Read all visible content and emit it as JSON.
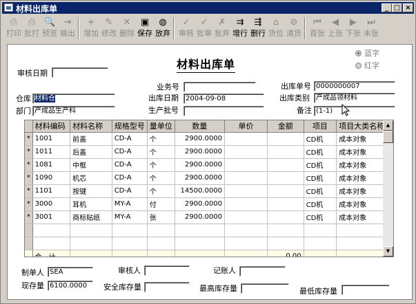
{
  "window": {
    "title": "材料出库单",
    "controls": [
      "_",
      "□",
      "×"
    ]
  },
  "toolbar": [
    {
      "label": "打印",
      "icon": "print-icon",
      "glyph": "⎙",
      "enabled": false
    },
    {
      "label": "批打",
      "icon": "batch-print-icon",
      "glyph": "⎙",
      "enabled": false
    },
    {
      "label": "预览",
      "icon": "preview-icon",
      "glyph": "🔍",
      "enabled": false
    },
    {
      "label": "输出",
      "icon": "export-icon",
      "glyph": "⇥",
      "enabled": false
    },
    {
      "label": "增加",
      "icon": "add-icon",
      "glyph": "+",
      "enabled": false
    },
    {
      "label": "修改",
      "icon": "edit-icon",
      "glyph": "✎",
      "enabled": false
    },
    {
      "label": "删除",
      "icon": "delete-icon",
      "glyph": "✕",
      "enabled": false
    },
    {
      "label": "保存",
      "icon": "save-icon",
      "glyph": "▣",
      "enabled": true
    },
    {
      "label": "放弃",
      "icon": "discard-icon",
      "glyph": "◍",
      "enabled": true
    },
    {
      "label": "审核",
      "icon": "audit-icon",
      "glyph": "✓",
      "enabled": false
    },
    {
      "label": "批审",
      "icon": "batch-audit-icon",
      "glyph": "✓",
      "enabled": false
    },
    {
      "label": "批弃",
      "icon": "batch-discard-icon",
      "glyph": "✗",
      "enabled": false
    },
    {
      "label": "增行",
      "icon": "add-row-icon",
      "glyph": "⇉",
      "enabled": true
    },
    {
      "label": "删行",
      "icon": "delete-row-icon",
      "glyph": "⇶",
      "enabled": true
    },
    {
      "label": "货位",
      "icon": "location-icon",
      "glyph": "⌂",
      "enabled": false
    },
    {
      "label": "清货",
      "icon": "clear-icon",
      "glyph": "⊜",
      "enabled": false
    },
    {
      "label": "首张",
      "icon": "first-icon",
      "glyph": "⏮",
      "enabled": false
    },
    {
      "label": "上张",
      "icon": "prev-icon",
      "glyph": "◀",
      "enabled": false
    },
    {
      "label": "下张",
      "icon": "next-icon",
      "glyph": "▶",
      "enabled": false
    },
    {
      "label": "末张",
      "icon": "last-icon",
      "glyph": "⏭",
      "enabled": false
    }
  ],
  "form": {
    "title": "材料出库单",
    "color_options": [
      {
        "label": "蓝字",
        "selected": true
      },
      {
        "label": "红字",
        "selected": false
      }
    ],
    "audit_date": {
      "label": "审核日期",
      "value": ""
    },
    "business_no": {
      "label": "业务号",
      "value": ""
    },
    "outbound_no": {
      "label": "出库单号",
      "value": "0000000007"
    },
    "warehouse": {
      "label": "仓库",
      "value": "材料仓"
    },
    "outbound_date": {
      "label": "出库日期",
      "value": "2004-09-08"
    },
    "outbound_type": {
      "label": "出库类别",
      "value": "产成品领材料"
    },
    "department": {
      "label": "部门",
      "value": "产成品生产科"
    },
    "batch_no": {
      "label": "生产批号",
      "value": ""
    },
    "remark": {
      "label": "备注",
      "value": "(1-1)"
    }
  },
  "table": {
    "columns": [
      "材料编码",
      "材料名称",
      "规格型号",
      "量单位",
      "数量",
      "单价",
      "金额",
      "项目",
      "项目大类名称"
    ],
    "rows": [
      {
        "mark": "*",
        "code": "1001",
        "name": "前盖",
        "spec": "CD-A",
        "unit": "个",
        "qty": "2900.0000",
        "price": "",
        "amount": "",
        "project": "CD机",
        "category": "成本对象"
      },
      {
        "mark": "*",
        "code": "1011",
        "name": "后盖",
        "spec": "CD-A",
        "unit": "个",
        "qty": "2900.0000",
        "price": "",
        "amount": "",
        "project": "CD机",
        "category": "成本对象"
      },
      {
        "mark": "*",
        "code": "1081",
        "name": "中框",
        "spec": "CD-A",
        "unit": "个",
        "qty": "2900.0000",
        "price": "",
        "amount": "",
        "project": "CD机",
        "category": "成本对象"
      },
      {
        "mark": "*",
        "code": "1090",
        "name": "机芯",
        "spec": "CD-A",
        "unit": "个",
        "qty": "2900.0000",
        "price": "",
        "amount": "",
        "project": "CD机",
        "category": "成本对象"
      },
      {
        "mark": "*",
        "code": "1101",
        "name": "按键",
        "spec": "CD-A",
        "unit": "个",
        "qty": "14500.0000",
        "price": "",
        "amount": "",
        "project": "CD机",
        "category": "成本对象"
      },
      {
        "mark": "*",
        "code": "3000",
        "name": "耳机",
        "spec": "MY-A",
        "unit": "付",
        "qty": "2900.0000",
        "price": "",
        "amount": "",
        "project": "CD机",
        "category": "成本对象"
      },
      {
        "mark": "*",
        "code": "3001",
        "name": "商标贴纸",
        "spec": "MY-A",
        "unit": "张",
        "qty": "2900.0000",
        "price": "",
        "amount": "",
        "project": "CD机",
        "category": "成本对象"
      }
    ],
    "total_label": "合　计",
    "total_amount": "0.00"
  },
  "footer": {
    "maker": {
      "label": "制单人",
      "value": "SEA"
    },
    "auditor": {
      "label": "审核人",
      "value": ""
    },
    "bookkeeper": {
      "label": "记账人",
      "value": ""
    },
    "stock": {
      "label": "现存量",
      "value": "6100.0000"
    },
    "safety_stock": {
      "label": "安全库存量",
      "value": ""
    },
    "max_stock": {
      "label": "最高库存量",
      "value": ""
    },
    "min_stock": {
      "label": "最低库存量",
      "value": ""
    }
  }
}
